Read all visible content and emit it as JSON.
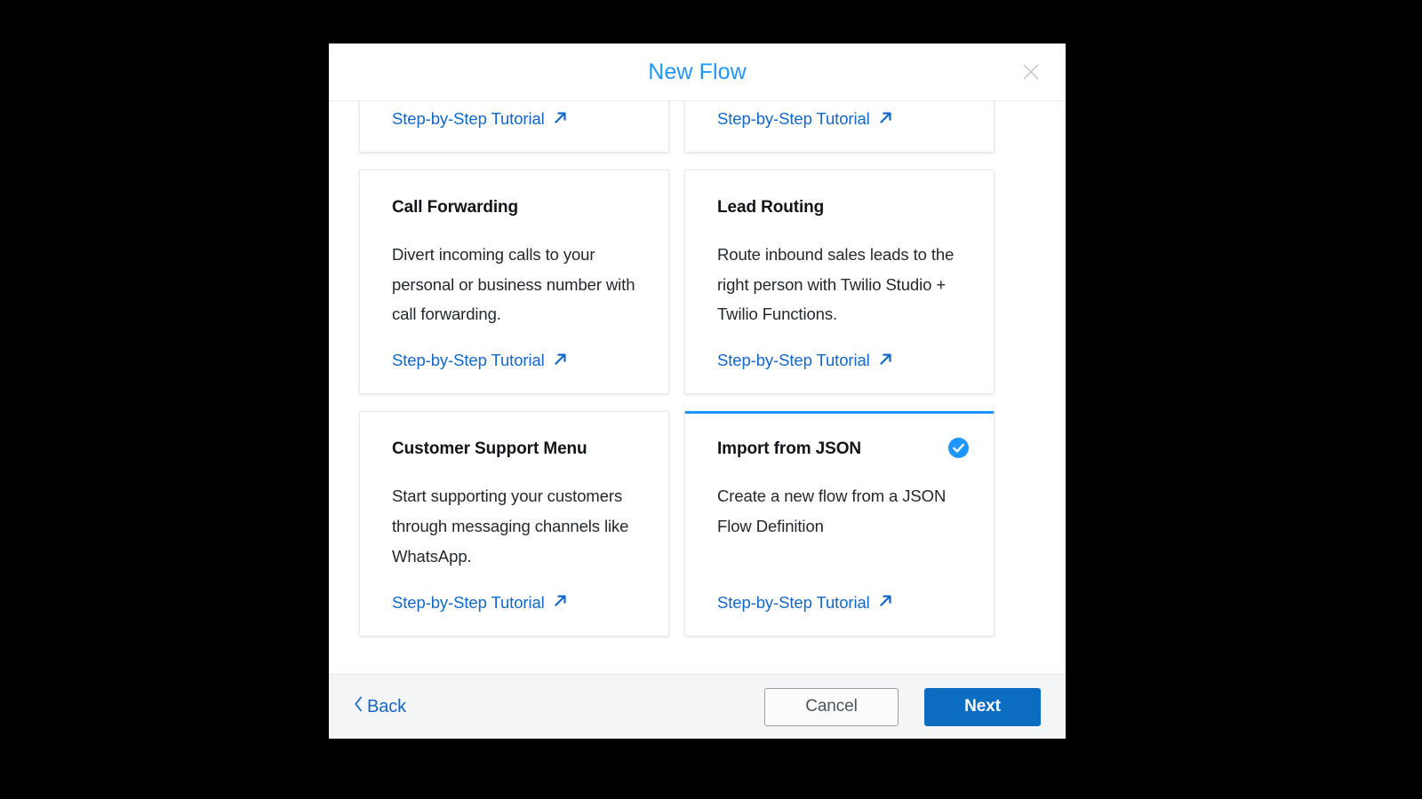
{
  "modal": {
    "title": "New Flow"
  },
  "cards": [
    {
      "title": "",
      "description": "",
      "link": "Step-by-Step Tutorial",
      "selected": false
    },
    {
      "title": "",
      "description": "",
      "link": "Step-by-Step Tutorial",
      "selected": false
    },
    {
      "title": "Call Forwarding",
      "description": "Divert incoming calls to your personal or business number with call forwarding.",
      "link": "Step-by-Step Tutorial",
      "selected": false
    },
    {
      "title": "Lead Routing",
      "description": "Route inbound sales leads to the right person with Twilio Studio + Twilio Functions.",
      "link": "Step-by-Step Tutorial",
      "selected": false
    },
    {
      "title": "Customer Support Menu",
      "description": "Start supporting your customers through messaging channels like WhatsApp.",
      "link": "Step-by-Step Tutorial",
      "selected": false
    },
    {
      "title": "Import from JSON",
      "description": "Create a new flow from a JSON Flow Definition",
      "link": "Step-by-Step Tutorial",
      "selected": true
    }
  ],
  "footer": {
    "back_label": "Back",
    "cancel_label": "Cancel",
    "next_label": "Next"
  },
  "colors": {
    "title_blue": "#1f96ff",
    "link_blue": "#1267c8",
    "primary_button_blue": "#0c6cbf",
    "selected_border_blue": "#1f96ff",
    "check_badge_blue": "#1f96ff",
    "footer_background": "#f4f5f7",
    "card_border": "#e7e9ec",
    "backdrop": "#000000"
  }
}
